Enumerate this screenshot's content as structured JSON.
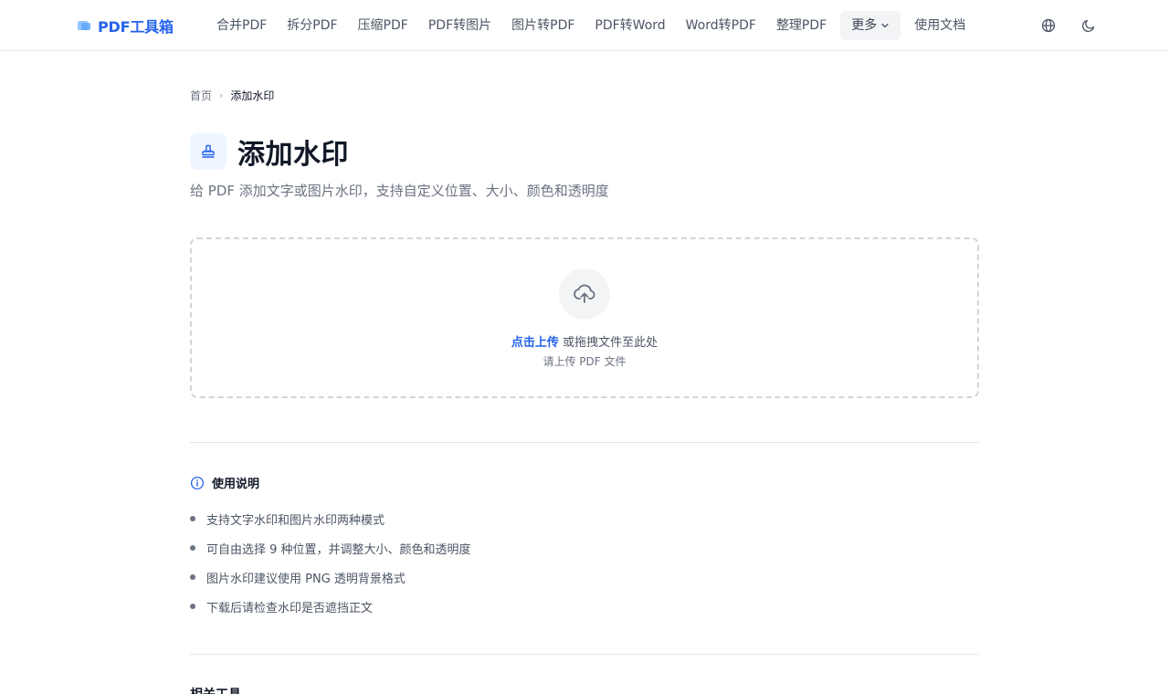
{
  "brand": {
    "name": "PDF工具箱"
  },
  "nav": {
    "items": [
      "合并PDF",
      "拆分PDF",
      "压缩PDF",
      "PDF转图片",
      "图片转PDF",
      "PDF转Word",
      "Word转PDF",
      "整理PDF"
    ],
    "more_label": "更多",
    "docs_label": "使用文档"
  },
  "breadcrumb": {
    "home": "首页",
    "separator": "›",
    "current": "添加水印"
  },
  "page": {
    "title": "添加水印",
    "subtitle": "给 PDF 添加文字或图片水印，支持自定义位置、大小、颜色和透明度"
  },
  "upload": {
    "link_label": "点击上传",
    "text": " 或拖拽文件至此处",
    "hint": "请上传 PDF 文件"
  },
  "usage": {
    "title": "使用说明",
    "items": [
      "支持文字水印和图片水印两种模式",
      "可自由选择 9 种位置，并调整大小、颜色和透明度",
      "图片水印建议使用 PNG 透明背景格式",
      "下载后请检查水印是否遮挡正文"
    ]
  },
  "related": {
    "title": "相关工具"
  },
  "colors": {
    "accent": "#2563eb",
    "text": "#111827",
    "muted": "#6b7280",
    "border": "#e5e7eb"
  }
}
